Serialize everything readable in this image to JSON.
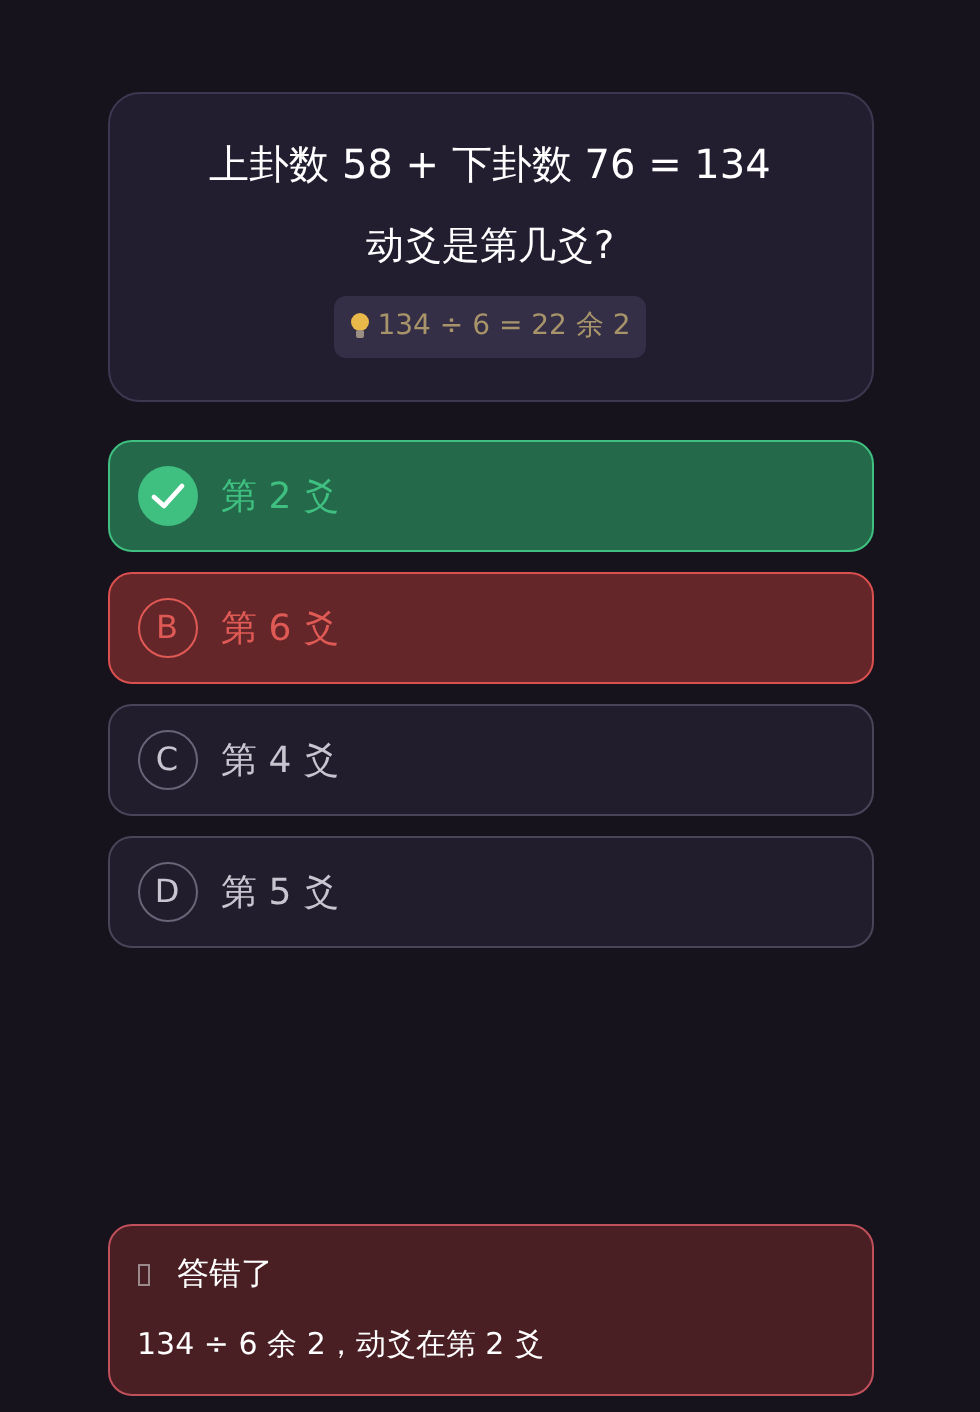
{
  "question": {
    "equation": "上卦数 58 + 下卦数 76 = 134",
    "prompt": "动爻是第几爻?",
    "hint": "134 ÷ 6 = 22 余 2"
  },
  "options": [
    {
      "kind": "correct",
      "text": "第 2 爻"
    },
    {
      "kind": "wrong",
      "letter": "B",
      "text": "第 6 爻"
    },
    {
      "kind": "neutral",
      "letter": "C",
      "text": "第 4 爻"
    },
    {
      "kind": "neutral",
      "letter": "D",
      "text": "第 5 爻"
    }
  ],
  "feedback": {
    "kind": "wrong",
    "title": "答错了",
    "explanation": "134 ÷ 6 余 2，动爻在第 2 爻"
  }
}
